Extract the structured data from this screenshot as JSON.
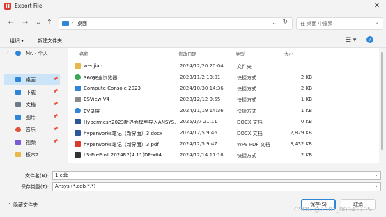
{
  "window": {
    "title": "Export File",
    "app_icon_letter": "H"
  },
  "nav": {
    "back": "←",
    "forward": "→",
    "recent": "⌄",
    "up": "↑"
  },
  "address": {
    "location": "桌面",
    "separator": "›"
  },
  "search": {
    "placeholder": "在 桌面 中搜索"
  },
  "toolbar": {
    "organize": "组织 ▾",
    "new_folder": "新建文件夹",
    "view": "☰ ▾",
    "help": "?"
  },
  "sidebar": {
    "items": [
      {
        "label": "Mr. - 个人",
        "color": "#2f86d6"
      },
      {
        "label": "桌面",
        "color": "#2f86d6",
        "selected": true
      },
      {
        "label": "下载",
        "color": "#2f86d6"
      },
      {
        "label": "文档",
        "color": "#6a7a8a"
      },
      {
        "label": "图片",
        "color": "#2f86d6"
      },
      {
        "label": "音乐",
        "color": "#e0533a"
      },
      {
        "label": "视频",
        "color": "#7a5ad6"
      },
      {
        "label": "板本2",
        "color": "#e8b84a"
      }
    ]
  },
  "list": {
    "columns": {
      "name": "名称",
      "date": "修改日期",
      "type": "类型",
      "size": "大小"
    },
    "rows": [
      {
        "name": "wenjian",
        "date": "2024/12/20 20:04",
        "type": "文件夹",
        "size": "",
        "color": "#e8b84a"
      },
      {
        "name": "360安全浏览器",
        "date": "2023/11/2 13:01",
        "type": "快捷方式",
        "size": "2 KB",
        "color": "#3aa857"
      },
      {
        "name": "Compute Console 2023",
        "date": "2024/10/30 14:36",
        "type": "快捷方式",
        "size": "2 KB",
        "color": "#2f86d6"
      },
      {
        "name": "ESView V4",
        "date": "2023/12/12 9:55",
        "type": "快捷方式",
        "size": "1 KB",
        "color": "#8a8a8a"
      },
      {
        "name": "EV录屏",
        "date": "2024/11/19 14:36",
        "type": "快捷方式",
        "size": "1 KB",
        "color": "#2f86d6"
      },
      {
        "name": "Hypermesh2023新界面模型导入ANSYS...",
        "date": "2025/1/7 21:11",
        "type": "DOCX 文档",
        "size": "0 KB",
        "color": "#2b5797"
      },
      {
        "name": "hyperworks笔记（新界面）3.docx",
        "date": "2024/12/5 9:46",
        "type": "DOCX 文档",
        "size": "2,829 KB",
        "color": "#2b5797"
      },
      {
        "name": "hyperworks笔记（新界面）3.pdf",
        "date": "2024/12/5 9:47",
        "type": "WPS PDF 文档",
        "size": "3,432 KB",
        "color": "#d93a2b"
      },
      {
        "name": "LS-PrePost 2024R2(4.11)DP-x64",
        "date": "2024/12/14 17:18",
        "type": "快捷方式",
        "size": "2 KB",
        "color": "#333333"
      }
    ]
  },
  "bottom": {
    "filename_label": "文件名(N):",
    "filename_value": "1.cdb",
    "filetype_label": "保存类型(T):",
    "filetype_value": "Ansys (*.cdb *.*)",
    "hide_folders": "隐藏文件夹",
    "save": "保存(S)",
    "cancel": "取消"
  },
  "watermark": "CSDN @2301_80941705"
}
